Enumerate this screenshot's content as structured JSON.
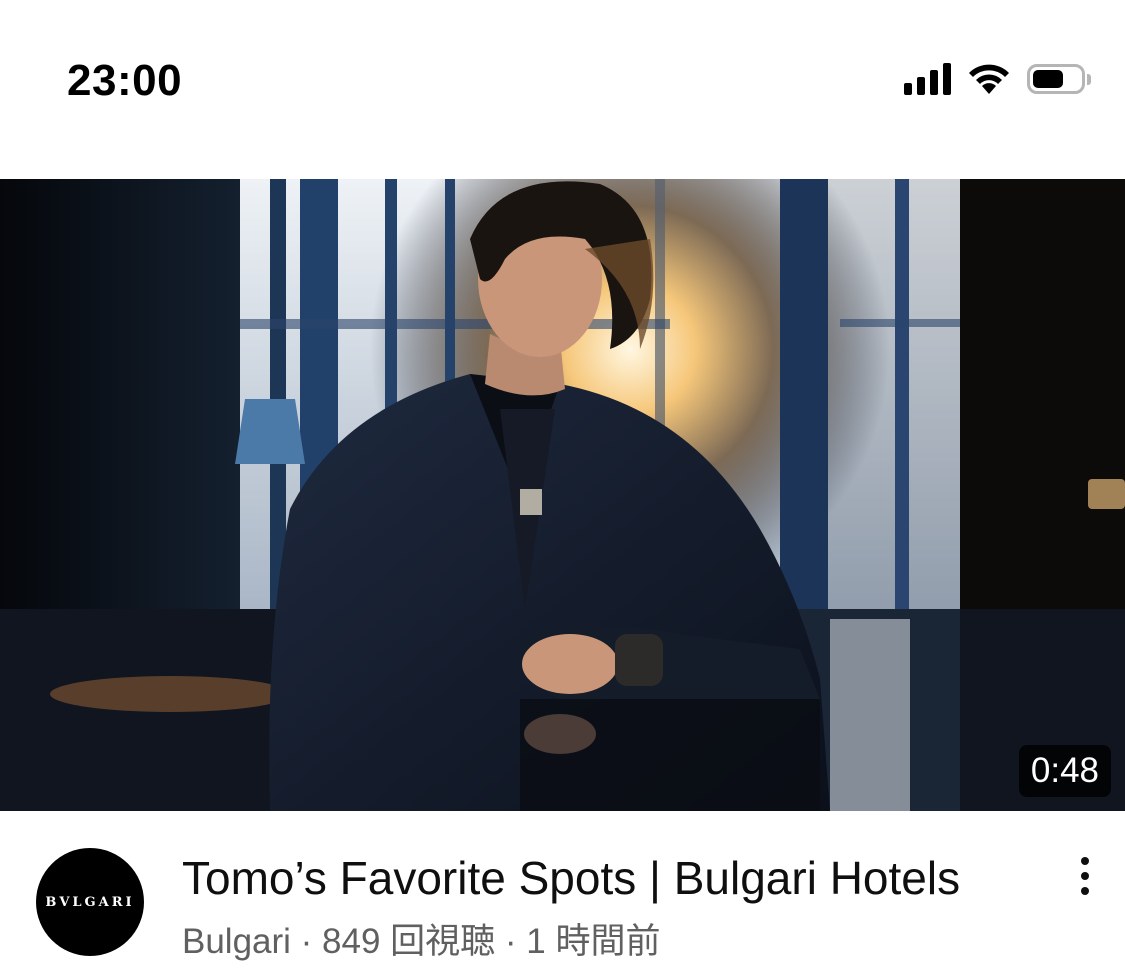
{
  "status_bar": {
    "time": "23:00",
    "icons": [
      "cellular-signal-icon",
      "wifi-icon",
      "battery-icon"
    ],
    "battery_level": 0.65
  },
  "video": {
    "duration": "0:48",
    "thumbnail": "man-in-dark-suit-by-window-thumbnail"
  },
  "channel": {
    "avatar_text": "BVLGARI",
    "name": "Bulgari"
  },
  "video_info": {
    "title": "Tomo’s Favorite Spots | Bulgari Hotels",
    "subtitle": "Bulgari · 849 回視聴 · 1 時間前"
  },
  "menu": {
    "icon": "more-vertical-icon"
  }
}
